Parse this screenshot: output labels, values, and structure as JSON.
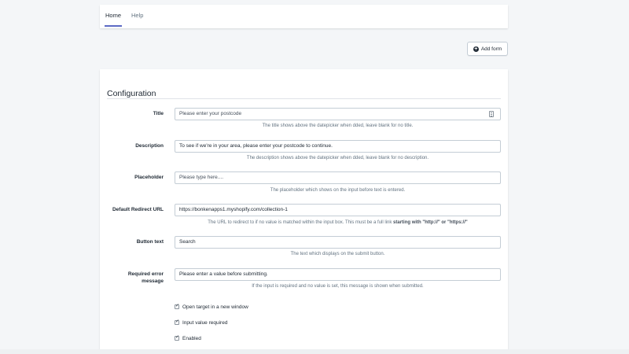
{
  "nav": {
    "tabs": [
      {
        "label": "Home",
        "active": true
      },
      {
        "label": "Help",
        "active": false
      }
    ]
  },
  "actions": {
    "add_form_label": "Add form",
    "add_form_icon": "plus-circle-icon"
  },
  "config": {
    "title": "Configuration",
    "fields": {
      "title": {
        "label": "Title",
        "value": "Please enter your postcode",
        "help": "The title shows above the datepicker when dded, leave blank for no title."
      },
      "description": {
        "label": "Description",
        "value": "To see if we're in your area, please enter your postcode to continue.",
        "help": "The description shows above the datepicker when dded, leave blank for no description."
      },
      "placeholder": {
        "label": "Placeholder",
        "value": "Please type here....",
        "help": "The placeholder which shows on the input before text is entered."
      },
      "redirect": {
        "label": "Default Redirect URL",
        "value": "https://bonkenapps1.myshopify.com/collection-1",
        "help_prefix": "The URL to redirect to if no value is matched within the input box. This must be a full link ",
        "help_bold": "starting with \"http://\" or \"https://\""
      },
      "button_text": {
        "label": "Button text",
        "value": "Search",
        "help": "The text which displays on the submit button."
      },
      "required_error": {
        "label_line1": "Required error",
        "label_line2": "message",
        "value": "Please enter a value before submitting.",
        "help": "If the input is required and no value is set, this message is shown when submitted."
      }
    },
    "checkboxes": [
      {
        "label": "Open target in a new window",
        "checked": true
      },
      {
        "label": "Input value required",
        "checked": true
      },
      {
        "label": "Enabled",
        "checked": true
      }
    ]
  },
  "colors": {
    "accent": "#5c6ac4",
    "background": "#f4f6f8"
  }
}
